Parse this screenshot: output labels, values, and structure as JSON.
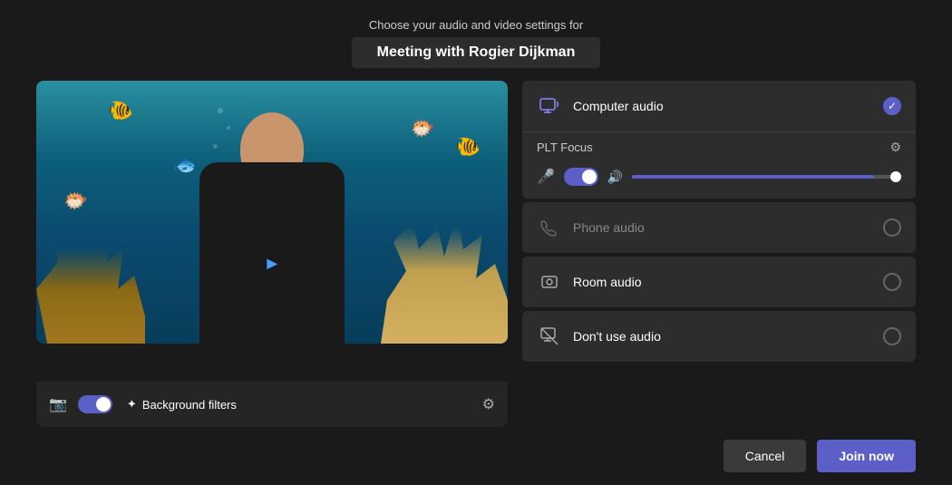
{
  "header": {
    "subtitle": "Choose your audio and video settings for",
    "title": "Meeting with Rogier Dijkman"
  },
  "video_panel": {
    "controls": {
      "toggle_state": "on",
      "bg_filters_label": "Background filters",
      "settings_label": "Settings"
    }
  },
  "audio_panel": {
    "computer_audio": {
      "label": "Computer audio",
      "plt_focus_label": "PLT Focus",
      "checked": true
    },
    "phone_audio": {
      "label": "Phone audio",
      "checked": false
    },
    "room_audio": {
      "label": "Room audio",
      "checked": false
    },
    "no_audio": {
      "label": "Don't use audio",
      "checked": false
    }
  },
  "footer": {
    "cancel_label": "Cancel",
    "join_label": "Join now"
  }
}
